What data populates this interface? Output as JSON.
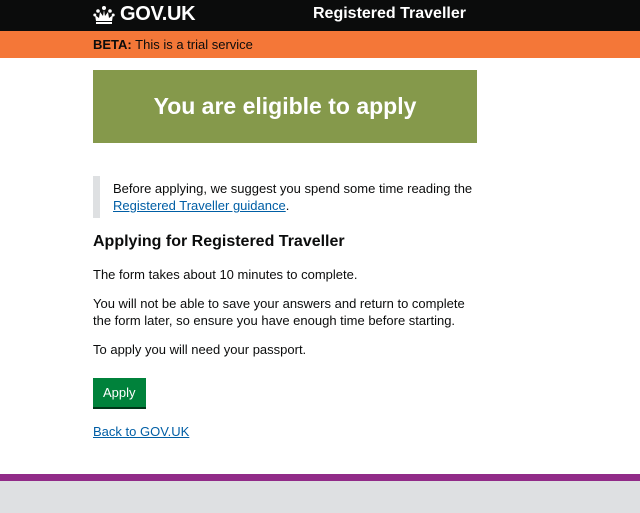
{
  "header": {
    "logo_text": "GOV.UK",
    "service_name": "Registered Traveller"
  },
  "phase_banner": {
    "tag": "BETA:",
    "text": " This is a trial service"
  },
  "panel": {
    "title": "You are eligible to apply"
  },
  "inset": {
    "text_before": "Before applying, we suggest you spend some time reading the ",
    "link_text": "Registered Traveller guidance",
    "text_after": "."
  },
  "content": {
    "heading": "Applying for Registered Traveller",
    "paragraphs": [
      "The form takes about 10 minutes to complete.",
      "You will not be able to save your answers and return to complete the form later, so ensure you have enough time before starting.",
      "To apply you will need your passport."
    ]
  },
  "actions": {
    "apply_label": "Apply",
    "back_link": "Back to GOV.UK"
  },
  "colors": {
    "header_bg": "#0b0c0c",
    "phase_bg": "#f47738",
    "panel_bg": "#85994b",
    "button_bg": "#00823b",
    "link": "#005ea5",
    "footer_border": "#912b88",
    "footer_bg": "#dee0e2"
  },
  "icons": {
    "logo": "crown-icon"
  }
}
